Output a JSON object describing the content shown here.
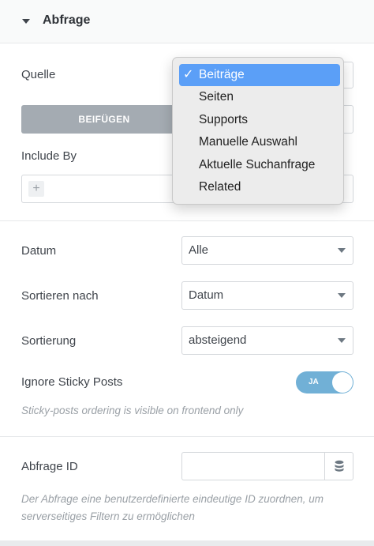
{
  "section": {
    "title": "Abfrage"
  },
  "query": {
    "source_label": "Quelle",
    "attach_button": "BEIFÜGEN",
    "include_by_label": "Include By",
    "include_add_glyph": "+",
    "source_options": [
      {
        "label": "Beiträge",
        "selected": true
      },
      {
        "label": "Seiten",
        "selected": false
      },
      {
        "label": "Supports",
        "selected": false
      },
      {
        "label": "Manuelle Auswahl",
        "selected": false
      },
      {
        "label": "Aktuelle Suchanfrage",
        "selected": false
      },
      {
        "label": "Related",
        "selected": false
      }
    ],
    "check_glyph": "✓"
  },
  "filters": {
    "date_label": "Datum",
    "date_value": "Alle",
    "order_by_label": "Sortieren nach",
    "order_by_value": "Datum",
    "order_label": "Sortierung",
    "order_value": "absteigend",
    "sticky_label": "Ignore Sticky Posts",
    "sticky_toggle_text": "JA",
    "sticky_hint": "Sticky-posts ordering is visible on frontend only"
  },
  "query_id": {
    "label": "Abfrage ID",
    "value": "",
    "hint": "Der Abfrage eine benutzerdefinierte eindeutige ID zuordnen, um serverseitiges Filtern zu ermöglichen"
  },
  "colors": {
    "accent_blue": "#5b9ff7",
    "toggle_on": "#71b0d6",
    "button_gray": "#a4abb2"
  }
}
